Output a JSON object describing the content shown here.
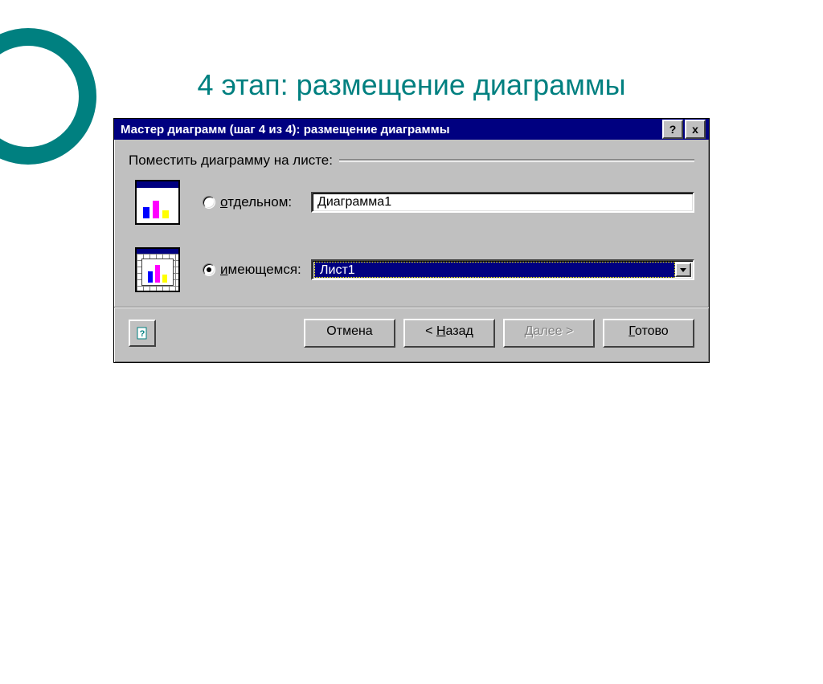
{
  "slide": {
    "title": "4 этап: размещение диаграммы"
  },
  "dialog": {
    "title": "Мастер диаграмм (шаг 4 из 4): размещение диаграммы",
    "help_glyph": "?",
    "close_glyph": "x",
    "group_label": "Поместить диаграмму на листе:",
    "option_separate": {
      "label_prefix": "о",
      "label_rest": "тдельном:",
      "value": "Диаграмма1",
      "selected": false
    },
    "option_existing": {
      "label_prefix": "и",
      "label_rest": "меющемся:",
      "value": "Лист1",
      "selected": true
    },
    "buttons": {
      "cancel": "Отмена",
      "back_prefix": "< ",
      "back_ul": "Н",
      "back_rest": "азад",
      "next_prefix": "",
      "next_ul": "Д",
      "next_rest": "алее >",
      "finish_ul": "Г",
      "finish_rest": "отово"
    }
  }
}
